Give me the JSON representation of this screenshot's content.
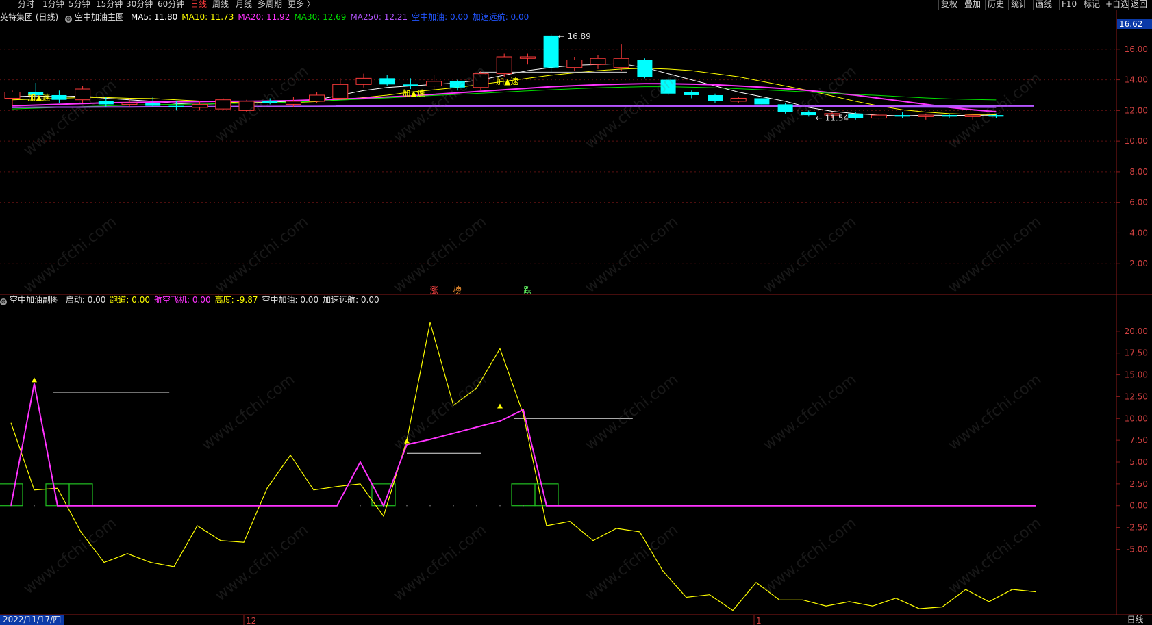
{
  "toolbar": {
    "left": [
      "分时",
      "1分钟",
      "5分钟",
      "15分钟",
      "30分钟",
      "60分钟",
      "日线",
      "周线",
      "月线",
      "多周期",
      "更多 〉"
    ],
    "active": "日线",
    "right": [
      "复权",
      "叠加",
      "历史",
      "统计",
      "画线",
      "F10",
      "标记",
      "+自选",
      "返回"
    ]
  },
  "main_header": {
    "stock": "英特集团 (日线)",
    "indicator": "空中加油主图",
    "items": [
      {
        "text": "MA5: 11.80",
        "color": "#ffffff"
      },
      {
        "text": "MA10: 11.73",
        "color": "#ffff00"
      },
      {
        "text": "MA20: 11.92",
        "color": "#ff33ff"
      },
      {
        "text": "MA30: 12.69",
        "color": "#00e000"
      },
      {
        "text": "MA250: 12.21",
        "color": "#b455ff"
      },
      {
        "text": "空中加油: 0.00",
        "color": "#2255ff"
      },
      {
        "text": "加速远航: 0.00",
        "color": "#2255ff"
      }
    ]
  },
  "sub_header": {
    "indicator": "空中加油副图",
    "items": [
      {
        "text": "启动: 0.00",
        "color": "#e0e0e0"
      },
      {
        "text": "跑道: 0.00",
        "color": "#ffff00"
      },
      {
        "text": "航空飞机: 0.00",
        "color": "#ff33ff"
      },
      {
        "text": "高度: -9.87",
        "color": "#ffff00"
      },
      {
        "text": "空中加油: 0.00",
        "color": "#e0e0e0"
      },
      {
        "text": "加速远航: 0.00",
        "color": "#e0e0e0"
      }
    ]
  },
  "footer": {
    "date": "2022/11/17/四",
    "period": "日线",
    "month_labels": [
      "12",
      "1"
    ]
  },
  "current_price": "16.62",
  "watermark": "www.cfchi.com",
  "chart_data": [
    {
      "type": "candlestick",
      "title": "英特集团 (日线)",
      "y_ticks": [
        2,
        4,
        6,
        8,
        10,
        12,
        14,
        16
      ],
      "y_tick_labels": [
        "2.00",
        "4.00",
        "6.00",
        "8.00",
        "10.00",
        "12.00",
        "14.00",
        "16.00"
      ],
      "ylim": [
        0,
        17.6
      ],
      "candles": [
        {
          "o": 12.8,
          "h": 13.3,
          "l": 12.3,
          "c": 13.2
        },
        {
          "o": 13.2,
          "h": 13.8,
          "l": 12.9,
          "c": 13.0
        },
        {
          "o": 13.0,
          "h": 13.3,
          "l": 12.5,
          "c": 12.7
        },
        {
          "o": 12.7,
          "h": 13.6,
          "l": 12.5,
          "c": 13.4
        },
        {
          "o": 12.6,
          "h": 12.9,
          "l": 12.2,
          "c": 12.4
        },
        {
          "o": 12.4,
          "h": 12.8,
          "l": 12.2,
          "c": 12.5
        },
        {
          "o": 12.5,
          "h": 12.9,
          "l": 12.2,
          "c": 12.3
        },
        {
          "o": 12.3,
          "h": 12.6,
          "l": 12.0,
          "c": 12.2
        },
        {
          "o": 12.2,
          "h": 12.6,
          "l": 12.0,
          "c": 12.4
        },
        {
          "o": 12.1,
          "h": 12.8,
          "l": 12.0,
          "c": 12.7
        },
        {
          "o": 12.0,
          "h": 12.7,
          "l": 11.9,
          "c": 12.6
        },
        {
          "o": 12.6,
          "h": 12.8,
          "l": 12.4,
          "c": 12.5
        },
        {
          "o": 12.4,
          "h": 12.9,
          "l": 12.2,
          "c": 12.6
        },
        {
          "o": 12.6,
          "h": 13.2,
          "l": 12.5,
          "c": 13.0
        },
        {
          "o": 12.8,
          "h": 14.1,
          "l": 12.7,
          "c": 13.7
        },
        {
          "o": 13.7,
          "h": 14.4,
          "l": 13.5,
          "c": 14.1
        },
        {
          "o": 14.1,
          "h": 14.3,
          "l": 13.6,
          "c": 13.7
        },
        {
          "o": 13.7,
          "h": 14.1,
          "l": 13.4,
          "c": 13.6
        },
        {
          "o": 13.6,
          "h": 14.3,
          "l": 13.4,
          "c": 13.9
        },
        {
          "o": 13.9,
          "h": 14.0,
          "l": 13.3,
          "c": 13.5
        },
        {
          "o": 13.5,
          "h": 14.6,
          "l": 13.3,
          "c": 14.4
        },
        {
          "o": 14.4,
          "h": 15.7,
          "l": 14.2,
          "c": 15.5
        },
        {
          "o": 15.4,
          "h": 15.7,
          "l": 15.0,
          "c": 15.5
        },
        {
          "o": 16.89,
          "h": 17.0,
          "l": 14.5,
          "c": 14.8
        },
        {
          "o": 14.8,
          "h": 15.5,
          "l": 14.6,
          "c": 15.3
        },
        {
          "o": 15.0,
          "h": 15.6,
          "l": 14.7,
          "c": 15.4
        },
        {
          "o": 14.8,
          "h": 16.3,
          "l": 14.6,
          "c": 15.4
        },
        {
          "o": 15.3,
          "h": 15.4,
          "l": 14.1,
          "c": 14.2
        },
        {
          "o": 14.0,
          "h": 14.2,
          "l": 13.0,
          "c": 13.1
        },
        {
          "o": 13.2,
          "h": 13.3,
          "l": 12.8,
          "c": 13.0
        },
        {
          "o": 13.0,
          "h": 13.1,
          "l": 12.5,
          "c": 12.6
        },
        {
          "o": 12.6,
          "h": 12.9,
          "l": 12.5,
          "c": 12.8
        },
        {
          "o": 12.8,
          "h": 12.9,
          "l": 12.3,
          "c": 12.4
        },
        {
          "o": 12.4,
          "h": 12.5,
          "l": 11.8,
          "c": 11.9
        },
        {
          "o": 11.9,
          "h": 12.0,
          "l": 11.6,
          "c": 11.7
        },
        {
          "o": 11.7,
          "h": 11.9,
          "l": 11.5,
          "c": 11.8
        },
        {
          "o": 11.8,
          "h": 11.9,
          "l": 11.4,
          "c": 11.5
        },
        {
          "o": 11.5,
          "h": 11.8,
          "l": 11.4,
          "c": 11.7
        },
        {
          "o": 11.7,
          "h": 11.9,
          "l": 11.5,
          "c": 11.6
        },
        {
          "o": 11.6,
          "h": 11.8,
          "l": 11.4,
          "c": 11.7
        },
        {
          "o": 11.7,
          "h": 11.8,
          "l": 11.5,
          "c": 11.6
        },
        {
          "o": 11.6,
          "h": 11.8,
          "l": 11.4,
          "c": 11.7
        },
        {
          "o": 11.7,
          "h": 11.8,
          "l": 11.5,
          "c": 11.6
        }
      ],
      "series": [
        {
          "name": "MA5",
          "color": "#ffffff",
          "values": [
            12.9,
            12.95,
            12.9,
            12.95,
            12.8,
            12.7,
            12.6,
            12.45,
            12.4,
            12.45,
            12.5,
            12.55,
            12.6,
            12.7,
            13.0,
            13.3,
            13.5,
            13.6,
            13.7,
            13.8,
            14.0,
            14.3,
            14.6,
            14.8,
            14.95,
            15.0,
            15.05,
            14.8,
            14.4,
            14.0,
            13.6,
            13.2,
            12.9,
            12.6,
            12.2,
            11.95,
            11.8,
            11.7,
            11.65,
            11.7,
            11.68,
            11.68,
            11.7
          ]
        },
        {
          "name": "MA10",
          "color": "#ffff00",
          "values": [
            12.7,
            12.75,
            12.8,
            12.85,
            12.85,
            12.8,
            12.78,
            12.7,
            12.62,
            12.55,
            12.5,
            12.5,
            12.52,
            12.58,
            12.7,
            12.85,
            13.0,
            13.2,
            13.35,
            13.5,
            13.7,
            13.9,
            14.1,
            14.3,
            14.45,
            14.6,
            14.7,
            14.75,
            14.7,
            14.6,
            14.4,
            14.2,
            13.9,
            13.6,
            13.3,
            12.95,
            12.6,
            12.3,
            12.05,
            11.9,
            11.8,
            11.75,
            11.73
          ]
        },
        {
          "name": "MA20",
          "color": "#ff33ff",
          "values": [
            12.3,
            12.35,
            12.4,
            12.45,
            12.5,
            12.52,
            12.55,
            12.57,
            12.58,
            12.6,
            12.6,
            12.62,
            12.65,
            12.7,
            12.75,
            12.8,
            12.88,
            12.95,
            13.05,
            13.15,
            13.25,
            13.35,
            13.45,
            13.55,
            13.62,
            13.68,
            13.72,
            13.75,
            13.75,
            13.72,
            13.68,
            13.6,
            13.52,
            13.42,
            13.3,
            13.15,
            13.0,
            12.8,
            12.6,
            12.4,
            12.2,
            12.05,
            11.92
          ]
        },
        {
          "name": "MA30",
          "color": "#00e000",
          "values": [
            12.1,
            12.15,
            12.2,
            12.25,
            12.3,
            12.35,
            12.38,
            12.4,
            12.42,
            12.45,
            12.48,
            12.5,
            12.55,
            12.6,
            12.68,
            12.75,
            12.82,
            12.9,
            12.98,
            13.05,
            13.12,
            13.2,
            13.28,
            13.35,
            13.42,
            13.48,
            13.52,
            13.55,
            13.55,
            13.52,
            13.48,
            13.42,
            13.35,
            13.28,
            13.2,
            13.12,
            13.05,
            12.98,
            12.9,
            12.82,
            12.76,
            12.72,
            12.69
          ]
        },
        {
          "name": "MA250",
          "color": "#b455ff",
          "values": [
            12.2,
            12.21,
            12.22,
            12.22,
            12.23,
            12.23,
            12.24,
            12.24,
            12.25,
            12.25,
            12.26,
            12.26,
            12.27,
            12.27,
            12.28,
            12.28,
            12.29,
            12.29,
            12.3,
            12.3,
            12.3,
            12.31,
            12.31,
            12.31,
            12.31,
            12.31,
            12.3,
            12.3,
            12.29,
            12.29,
            12.28,
            12.28,
            12.27,
            12.26,
            12.26,
            12.25,
            12.24,
            12.24,
            12.23,
            12.23,
            12.22,
            12.22,
            12.21
          ]
        }
      ],
      "annotations": [
        {
          "text": "16.89",
          "candle": 23,
          "y": 16.89
        },
        {
          "text": "11.54",
          "candle": 34,
          "y": 11.54
        },
        {
          "text": "加▲速",
          "candle": 1,
          "y": 12.85
        },
        {
          "text": "加▲速",
          "candle": 17,
          "y": 13.1
        },
        {
          "text": "加▲速",
          "candle": 21,
          "y": 13.9
        }
      ],
      "bottom_labels": [
        {
          "text": "涨",
          "candle": 18,
          "color": "#ff4444"
        },
        {
          "text": "榜",
          "candle": 19,
          "color": "#ff9933"
        },
        {
          "text": "跌",
          "candle": 22,
          "color": "#66ff66"
        }
      ]
    },
    {
      "type": "line",
      "title": "空中加油副图",
      "y_ticks": [
        -5,
        -2.5,
        0,
        2.5,
        5,
        7.5,
        10,
        12.5,
        15,
        17.5,
        20
      ],
      "y_tick_labels": [
        "-5.00",
        "-2.50",
        "0.00",
        "2.50",
        "5.00",
        "7.50",
        "10.00",
        "12.50",
        "15.00",
        "17.50",
        "20.00"
      ],
      "ylim": [
        -12.5,
        22.5
      ],
      "series": [
        {
          "name": "高度",
          "color": "#ffff00",
          "values": [
            9.5,
            1.8,
            2.0,
            -3.0,
            -6.5,
            -5.5,
            -6.5,
            -7.0,
            -2.3,
            -4.0,
            -4.2,
            2.0,
            5.8,
            1.8,
            2.2,
            2.5,
            -1.2,
            7.5,
            21.0,
            11.5,
            13.5,
            18.0,
            10.5,
            -2.3,
            -1.8,
            -4.0,
            -2.6,
            -3.0,
            -7.5,
            -10.5,
            -10.2,
            -12.0,
            -8.8,
            -10.8,
            -10.8,
            -11.5,
            -11.0,
            -11.5,
            -10.6,
            -11.8,
            -11.6,
            -9.6,
            -11.0,
            -9.6,
            -9.87
          ]
        },
        {
          "name": "航空飞机",
          "color": "#ff33ff",
          "values": [
            0,
            14.0,
            0,
            0,
            0,
            0,
            0,
            0,
            0,
            0,
            0,
            0,
            0,
            0,
            0,
            5.0,
            0,
            7.0,
            7.6,
            8.3,
            9.0,
            9.7,
            11.0,
            0,
            0,
            0,
            0,
            0,
            0,
            0,
            0,
            0,
            0,
            0,
            0,
            0,
            0,
            0,
            0,
            0,
            0,
            0,
            0,
            0,
            0
          ]
        }
      ],
      "launch_boxes": [
        0,
        2,
        3,
        16,
        22,
        23
      ],
      "signal_markers": [
        {
          "index": 1,
          "y": 14.0
        },
        {
          "index": 17,
          "y": 7.0
        },
        {
          "index": 21,
          "y": 11.0
        }
      ],
      "reference_lines": [
        {
          "from": 1.8,
          "to": 6.8,
          "y": 13.0
        },
        {
          "from": 17.0,
          "to": 20.2,
          "y": 6.0
        },
        {
          "from": 21.6,
          "to": 26.7,
          "y": 10.0
        }
      ]
    }
  ]
}
